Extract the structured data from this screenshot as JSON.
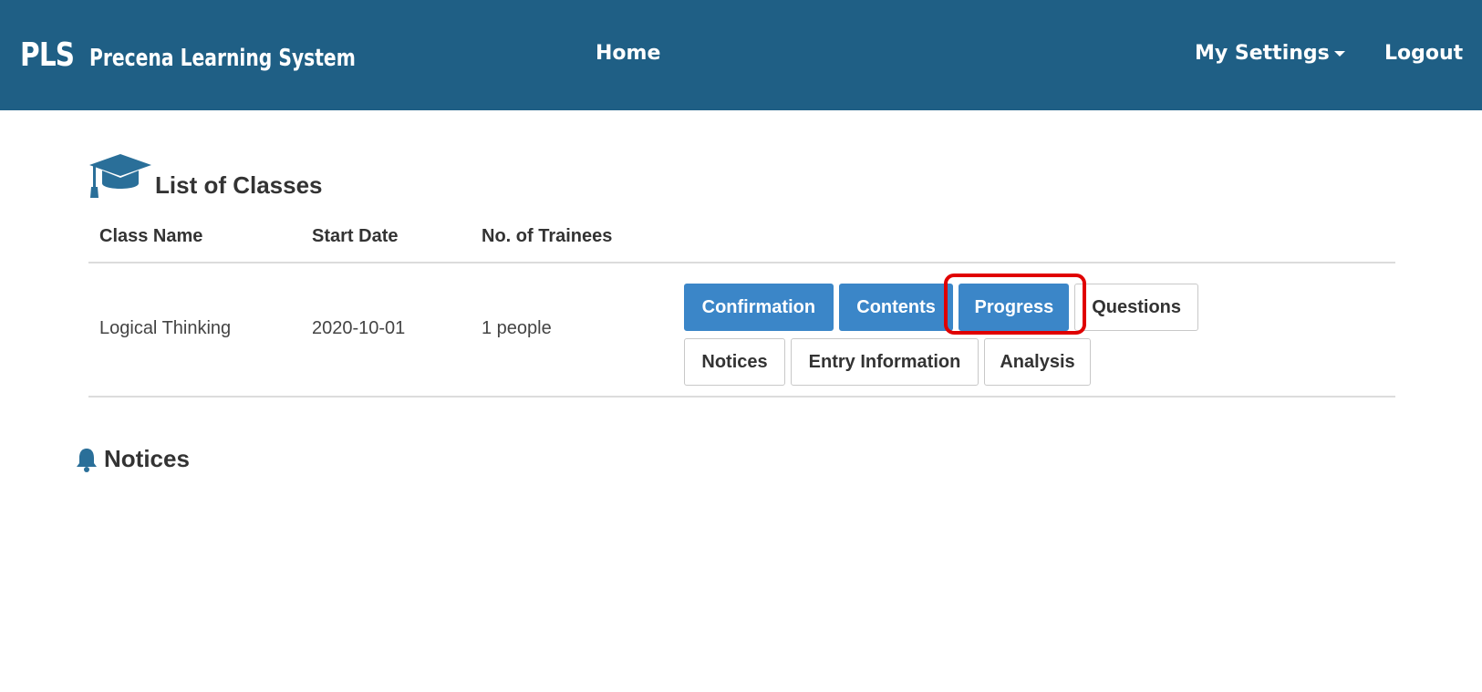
{
  "header": {
    "logo": "PLS",
    "brand": "Precena Learning System",
    "nav": {
      "home": "Home",
      "settings": "My Settings",
      "logout": "Logout"
    }
  },
  "classes": {
    "title": "List of Classes",
    "columns": {
      "class_name": "Class Name",
      "start_date": "Start Date",
      "trainees": "No. of Trainees"
    },
    "rows": [
      {
        "class_name": "Logical Thinking",
        "start_date": "2020-10-01",
        "trainees": "1 people",
        "actions": {
          "confirmation": "Confirmation",
          "contents": "Contents",
          "progress": "Progress",
          "questions": "Questions",
          "notices": "Notices",
          "entry_information": "Entry Information",
          "analysis": "Analysis"
        }
      }
    ]
  },
  "notices": {
    "title": "Notices"
  },
  "colors": {
    "navbar": "#1f5f85",
    "primary_button": "#3b86c8",
    "highlight": "#e00000",
    "icon": "#2a6f99"
  },
  "icons": {
    "classes": "graduation-cap-icon",
    "notices": "bell-icon",
    "settings": "caret-down-icon"
  }
}
